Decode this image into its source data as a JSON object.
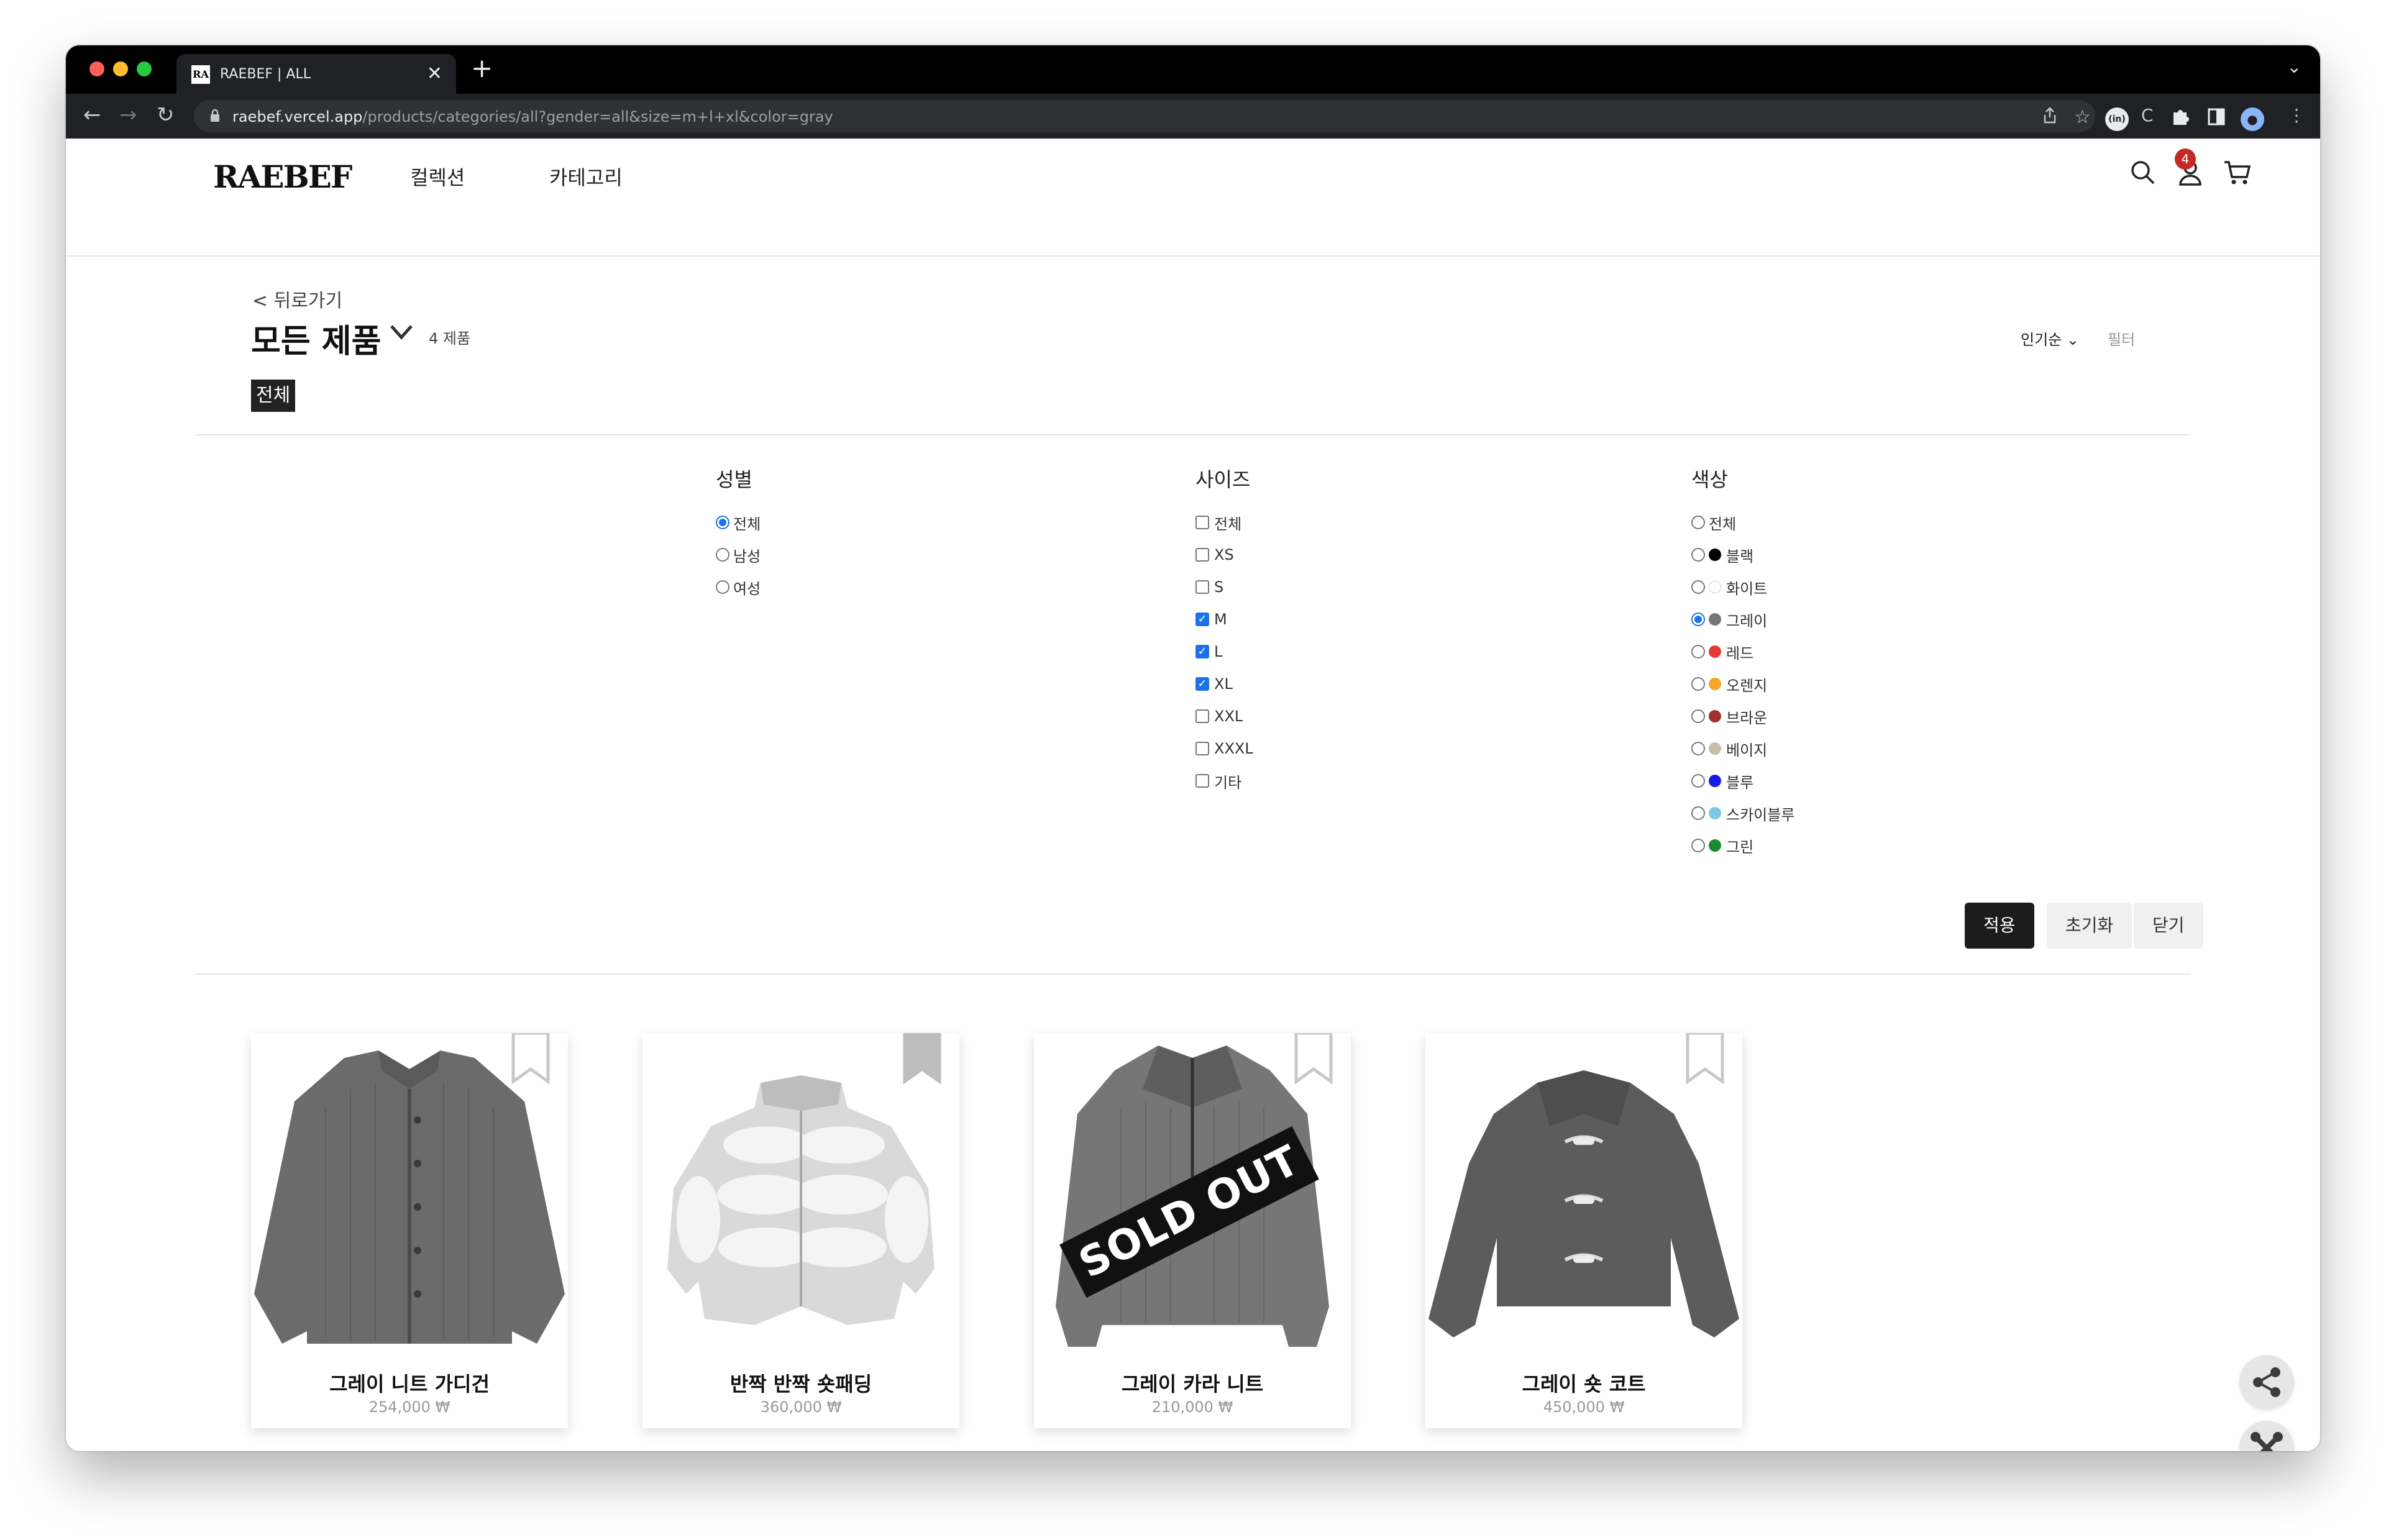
{
  "browser": {
    "tab_title": "RAEBEF | ALL",
    "tab_favicon": "RA",
    "tab_close": "✕",
    "new_tab": "+",
    "url_host": "raebef.vercel.app",
    "url_path": "/products/categories/all?gender=all&size=m+l+xl&color=gray",
    "ext_badge": "(in)"
  },
  "header": {
    "logo": "RAEBEF",
    "nav": [
      "컬렉션",
      "카테고리"
    ],
    "cart_count": "4"
  },
  "page": {
    "back_label": "< 뒤로가기",
    "title": "모든 제품",
    "product_count": "4 제품",
    "sort_label": "인기순 ⌄",
    "filter_label": "필터",
    "category_chip": "전체"
  },
  "filters": {
    "gender": {
      "heading": "성별",
      "options": [
        {
          "label": "전체",
          "selected": true
        },
        {
          "label": "남성",
          "selected": false
        },
        {
          "label": "여성",
          "selected": false
        }
      ]
    },
    "size": {
      "heading": "사이즈",
      "options": [
        {
          "label": "전체",
          "checked": false
        },
        {
          "label": "XS",
          "checked": false
        },
        {
          "label": "S",
          "checked": false
        },
        {
          "label": "M",
          "checked": true
        },
        {
          "label": "L",
          "checked": true
        },
        {
          "label": "XL",
          "checked": true
        },
        {
          "label": "XXL",
          "checked": false
        },
        {
          "label": "XXXL",
          "checked": false
        },
        {
          "label": "기타",
          "checked": false
        }
      ]
    },
    "color": {
      "heading": "색상",
      "options": [
        {
          "label": "전체",
          "swatch": null,
          "selected": false
        },
        {
          "label": "블랙",
          "swatch": "#000000",
          "selected": false
        },
        {
          "label": "화이트",
          "swatch": "#ffffff",
          "selected": false
        },
        {
          "label": "그레이",
          "swatch": "#777777",
          "selected": true
        },
        {
          "label": "레드",
          "swatch": "#e53935",
          "selected": false
        },
        {
          "label": "오렌지",
          "swatch": "#f5a623",
          "selected": false
        },
        {
          "label": "브라운",
          "swatch": "#a0302a",
          "selected": false
        },
        {
          "label": "베이지",
          "swatch": "#c9bca8",
          "selected": false
        },
        {
          "label": "블루",
          "swatch": "#1a1ae6",
          "selected": false
        },
        {
          "label": "스카이블루",
          "swatch": "#7ec8e3",
          "selected": false
        },
        {
          "label": "그린",
          "swatch": "#1b8a2f",
          "selected": false
        }
      ]
    },
    "buttons": {
      "apply": "적용",
      "reset": "초기화",
      "close": "닫기"
    }
  },
  "products": [
    {
      "name": "그레이 니트 가디건",
      "price": "254,000 ₩",
      "bookmarked": false,
      "sold_out": false
    },
    {
      "name": "반짝 반짝 숏패딩",
      "price": "360,000 ₩",
      "bookmarked": true,
      "sold_out": false
    },
    {
      "name": "그레이 카라 니트",
      "price": "210,000 ₩",
      "bookmarked": false,
      "sold_out": true,
      "sold_out_label": "SOLD OUT"
    },
    {
      "name": "그레이 숏 코트",
      "price": "450,000 ₩",
      "bookmarked": false,
      "sold_out": false
    }
  ],
  "icons": {
    "search": "search-icon",
    "user": "user-icon",
    "cart": "cart-icon",
    "share": "share-icon",
    "tools": "tools-icon"
  }
}
